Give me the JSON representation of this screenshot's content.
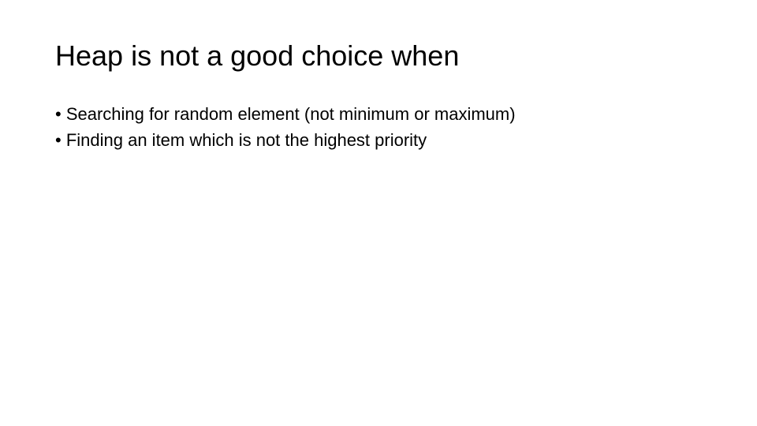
{
  "slide": {
    "title": "Heap is not a good choice when",
    "bullets": [
      "Searching for random element (not minimum or maximum)",
      "Finding an item which is not the highest priority"
    ]
  }
}
